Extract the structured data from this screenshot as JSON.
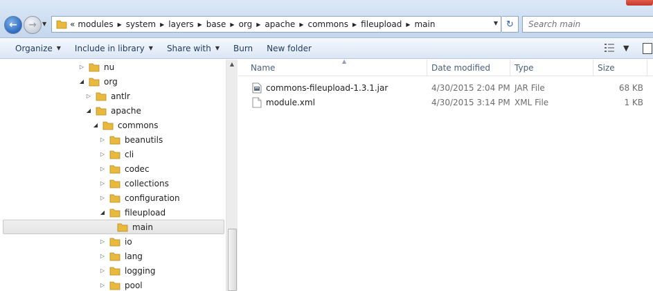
{
  "address": {
    "overflow_marker": "«",
    "crumbs": [
      "modules",
      "system",
      "layers",
      "base",
      "org",
      "apache",
      "commons",
      "fileupload",
      "main"
    ]
  },
  "search": {
    "placeholder": "Search main"
  },
  "toolbar": {
    "organize": "Organize",
    "include_in_library": "Include in library",
    "share_with": "Share with",
    "burn": "Burn",
    "new_folder": "New folder"
  },
  "tree": {
    "items": [
      {
        "label": "nu",
        "expanded": false
      },
      {
        "label": "org",
        "expanded": true
      },
      {
        "label": "antlr",
        "expanded": false
      },
      {
        "label": "apache",
        "expanded": true
      },
      {
        "label": "commons",
        "expanded": true
      },
      {
        "label": "beanutils",
        "expanded": false
      },
      {
        "label": "cli",
        "expanded": false
      },
      {
        "label": "codec",
        "expanded": false
      },
      {
        "label": "collections",
        "expanded": false
      },
      {
        "label": "configuration",
        "expanded": false
      },
      {
        "label": "fileupload",
        "expanded": true
      },
      {
        "label": "main",
        "expanded": false,
        "selected": true
      },
      {
        "label": "io",
        "expanded": false
      },
      {
        "label": "lang",
        "expanded": false
      },
      {
        "label": "logging",
        "expanded": false
      },
      {
        "label": "pool",
        "expanded": false
      }
    ]
  },
  "columns": {
    "name": "Name",
    "date": "Date modified",
    "type": "Type",
    "size": "Size"
  },
  "files": [
    {
      "name": "commons-fileupload-1.3.1.jar",
      "date": "4/30/2015 2:04 PM",
      "type": "JAR File",
      "size": "68 KB",
      "icon": "jar-file-icon"
    },
    {
      "name": "module.xml",
      "date": "4/30/2015 3:14 PM",
      "type": "XML File",
      "size": "1 KB",
      "icon": "xml-file-icon"
    }
  ],
  "colors": {
    "folder": "#e8b93c",
    "selection": "#e6e6e6",
    "header_text": "#4c607a"
  }
}
